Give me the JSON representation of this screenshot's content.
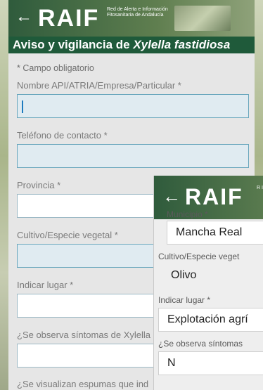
{
  "screen1": {
    "back_icon": "←",
    "logo": "RAIF",
    "logo_subtitle": "Red de Alerta e Información Fitosanitaria de Andalucía",
    "title_prefix": "Aviso y vigilancia de ",
    "title_species": "Xylella fastidiosa",
    "required_note": "* Campo obligatorio",
    "fields": [
      {
        "label": "Nombre API/ATRIA/Empresa/Particular *",
        "value": ""
      },
      {
        "label": "Teléfono de contacto *",
        "value": ""
      },
      {
        "label": "Provincia *",
        "value": ""
      },
      {
        "label": "Cultivo/Especie vegetal *",
        "value": ""
      },
      {
        "label": "Indicar lugar *",
        "value": ""
      },
      {
        "label": "¿Se observa síntomas de Xylella",
        "value": ""
      },
      {
        "label": "¿Se visualizan espumas que ind vectores de Xylella fastidiosa? *",
        "value": ""
      }
    ]
  },
  "screen2": {
    "back_icon": "←",
    "logo": "RAIF",
    "logo_subtitle": "R In d",
    "fields": [
      {
        "label": "Municipio *",
        "value": "Mancha Real"
      },
      {
        "label": "Cultivo/Especie veget",
        "value": "Olivo"
      },
      {
        "label": "Indicar lugar *",
        "value": "Explotación agrí"
      },
      {
        "label": "¿Se observa síntomas",
        "value": "N"
      }
    ]
  }
}
